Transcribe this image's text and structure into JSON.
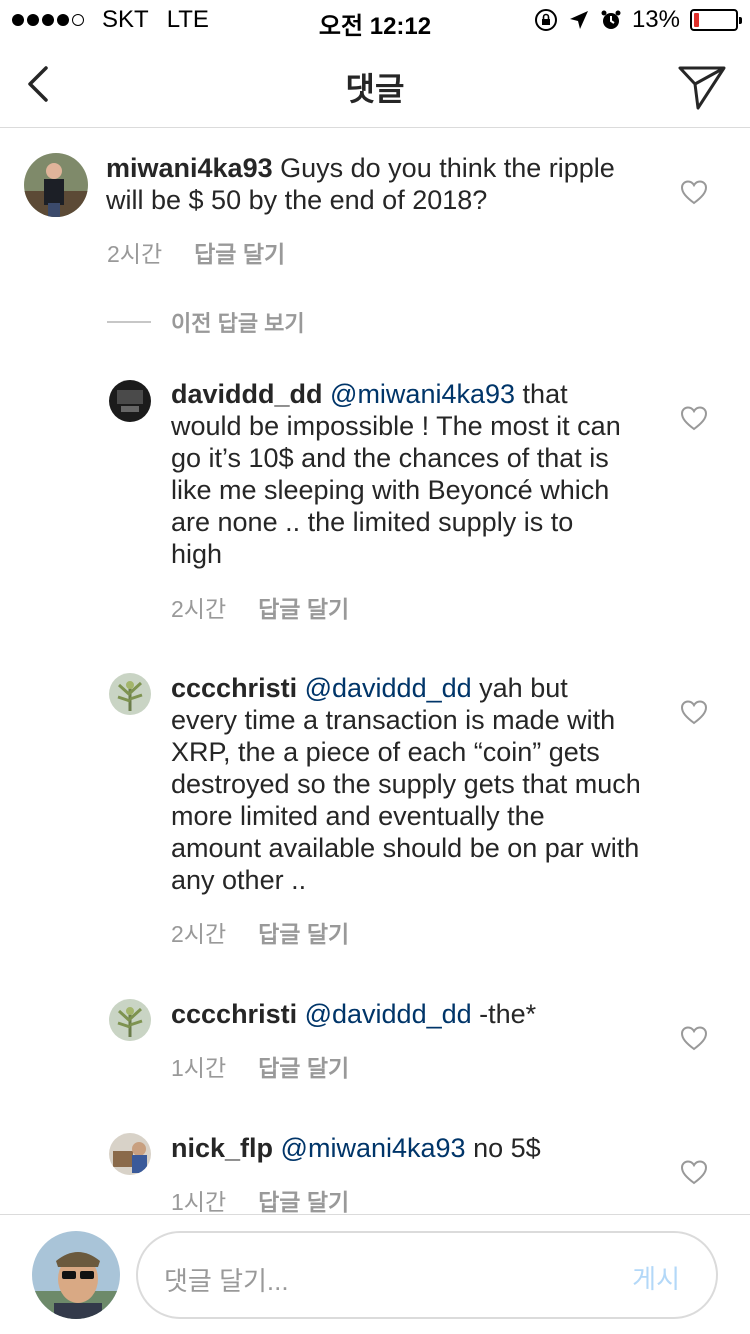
{
  "status_bar": {
    "carrier": "SKT",
    "network": "LTE",
    "time": "오전 12:12",
    "battery_percent": "13%",
    "battery_level": 0.13,
    "battery_color": "#e0302b"
  },
  "nav": {
    "title": "댓글",
    "back_icon": "chevron-left-icon",
    "send_icon": "paper-plane-icon"
  },
  "comments": [
    {
      "username": "miwani4ka93",
      "mention": "",
      "text": "Guys do you think the ripple will be $ 50 by the end of 2018?",
      "time": "2시간",
      "reply_label": "답글 달기"
    },
    {
      "username": "daviddd_dd",
      "mention": "@miwani4ka93",
      "text": "that would be impossible ! The most it can go it’s 10$ and the chances of that is like me sleeping with Beyoncé which are none .. the limited supply is to high",
      "time": "2시간",
      "reply_label": "답글 달기"
    },
    {
      "username": "cccchristi",
      "mention": "@daviddd_dd",
      "text": "yah but every time a transaction is made with XRP, the a piece of each “coin” gets destroyed so the supply gets that much more limited  and eventually the amount available should be on par with any other ..",
      "time": "2시간",
      "reply_label": "답글 달기"
    },
    {
      "username": "cccchristi",
      "mention": "@daviddd_dd",
      "text": "-the*",
      "time": "1시간",
      "reply_label": "답글 달기"
    },
    {
      "username": "nick_flp",
      "mention": "@miwani4ka93",
      "text": "no 5$",
      "time": "1시간",
      "reply_label": "답글 달기"
    }
  ],
  "view_previous_replies": "이전 답글 보기",
  "composer": {
    "placeholder": "댓글 달기...",
    "post_label": "게시"
  },
  "colors": {
    "mention": "#003569",
    "meta_gray": "#999999",
    "post_disabled": "#b3d8f8"
  }
}
